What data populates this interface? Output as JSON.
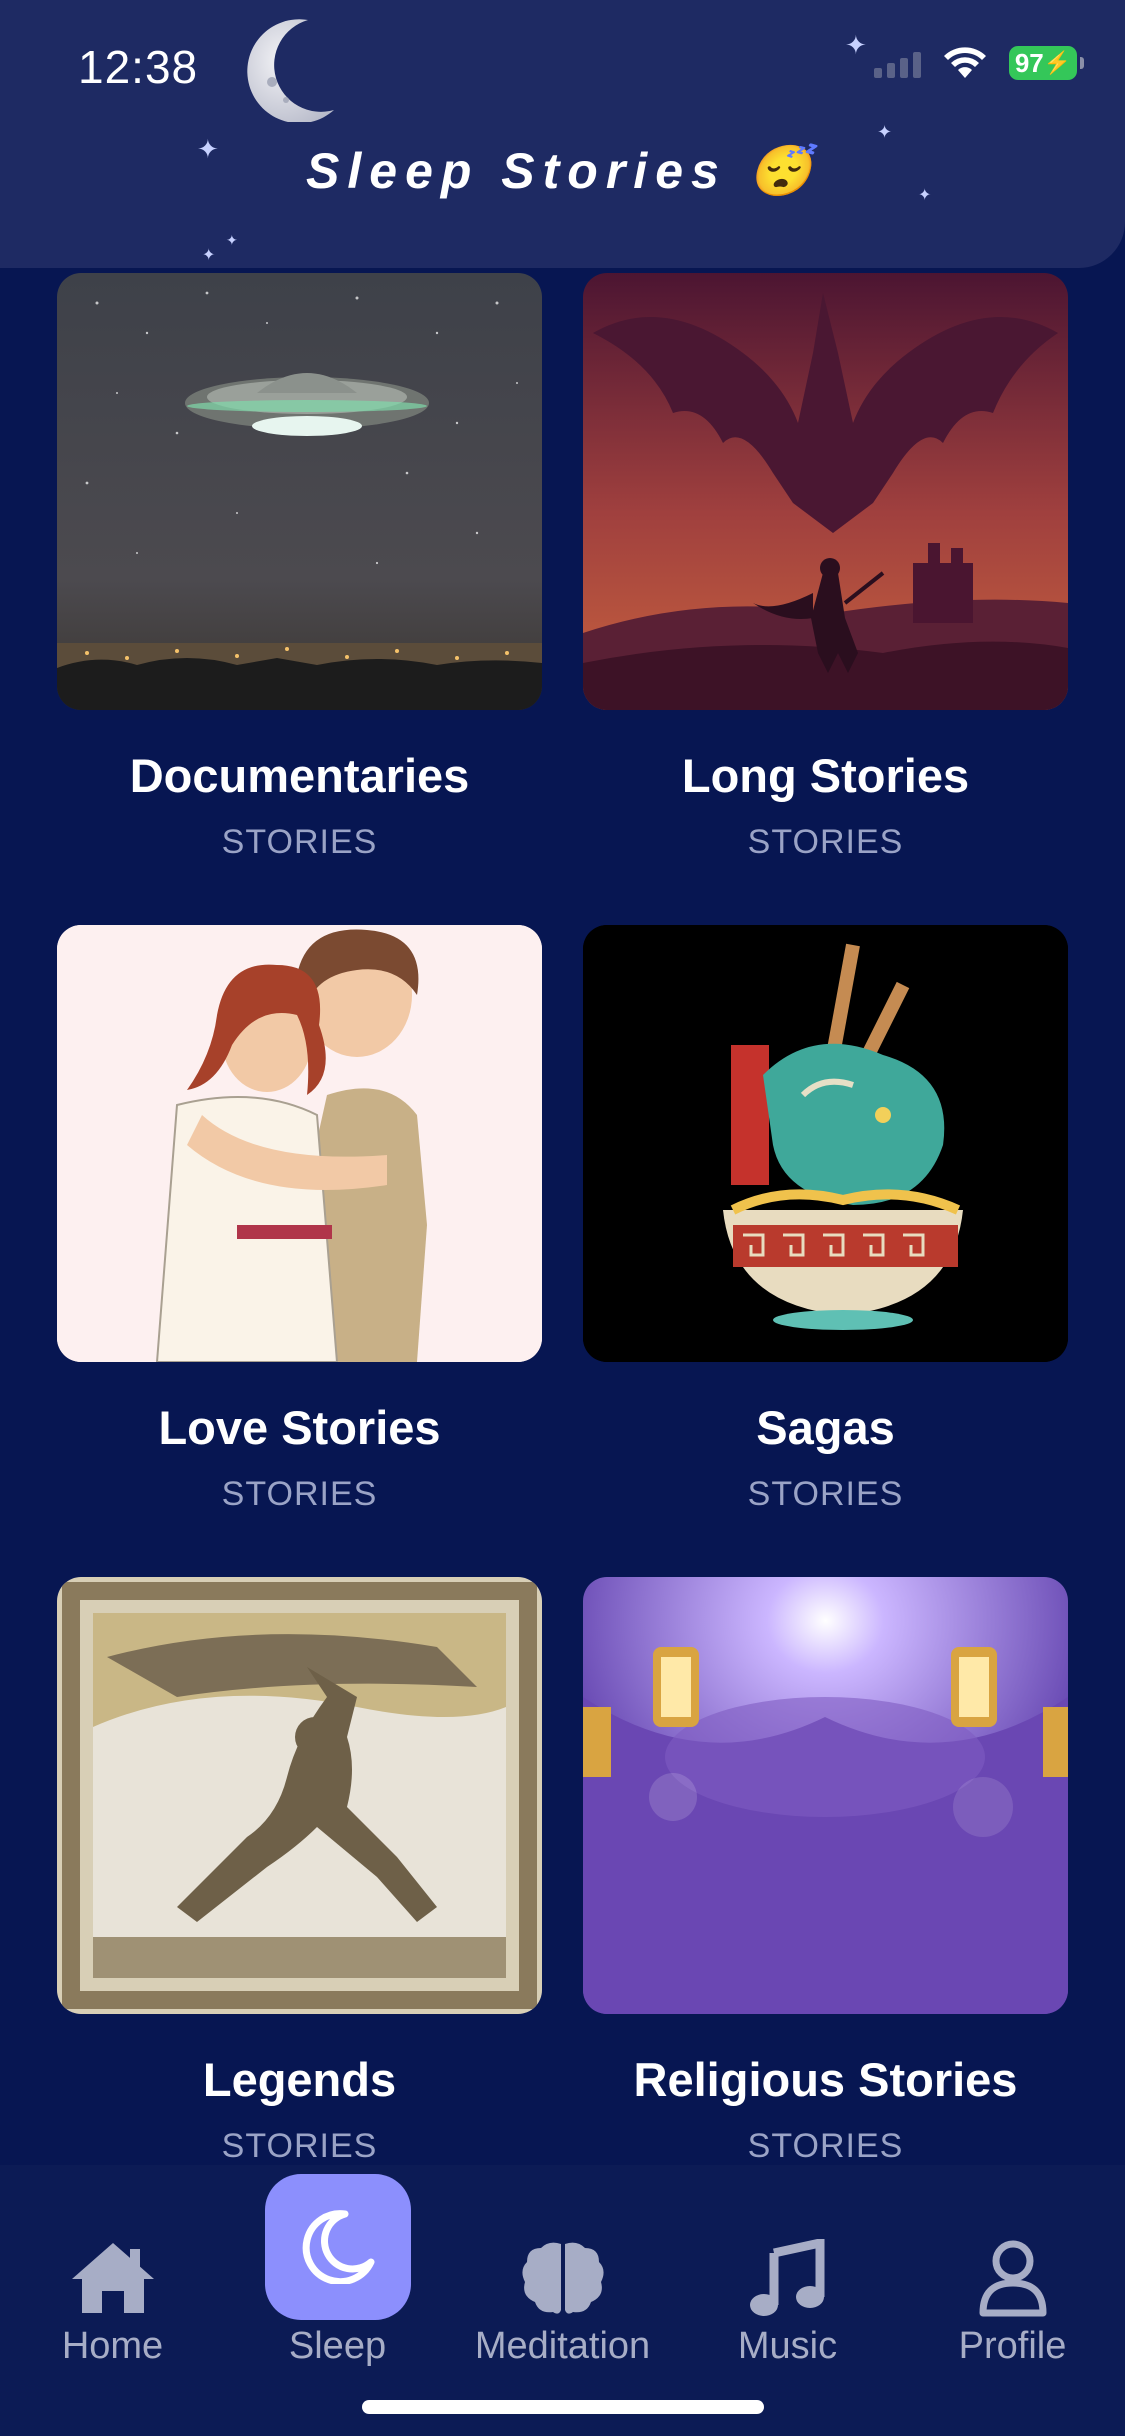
{
  "status_bar": {
    "time": "12:38",
    "battery": "97"
  },
  "header": {
    "title": "Sleep Stories 😴"
  },
  "cards": [
    {
      "title": "Documentaries",
      "subtitle": "STORIES"
    },
    {
      "title": "Long Stories",
      "subtitle": "STORIES"
    },
    {
      "title": "Love Stories",
      "subtitle": "STORIES"
    },
    {
      "title": "Sagas",
      "subtitle": "STORIES"
    },
    {
      "title": "Legends",
      "subtitle": "STORIES"
    },
    {
      "title": "Religious Stories",
      "subtitle": "STORIES"
    }
  ],
  "tabs": [
    {
      "label": "Home",
      "icon": "home-icon"
    },
    {
      "label": "Sleep",
      "icon": "moon-icon",
      "active": true
    },
    {
      "label": "Meditation",
      "icon": "brain-icon"
    },
    {
      "label": "Music",
      "icon": "music-note-icon"
    },
    {
      "label": "Profile",
      "icon": "person-icon"
    }
  ],
  "colors": {
    "background": "#071652",
    "header": "#1e2a63",
    "tab_active": "#8c8ffd",
    "battery": "#34c759"
  }
}
